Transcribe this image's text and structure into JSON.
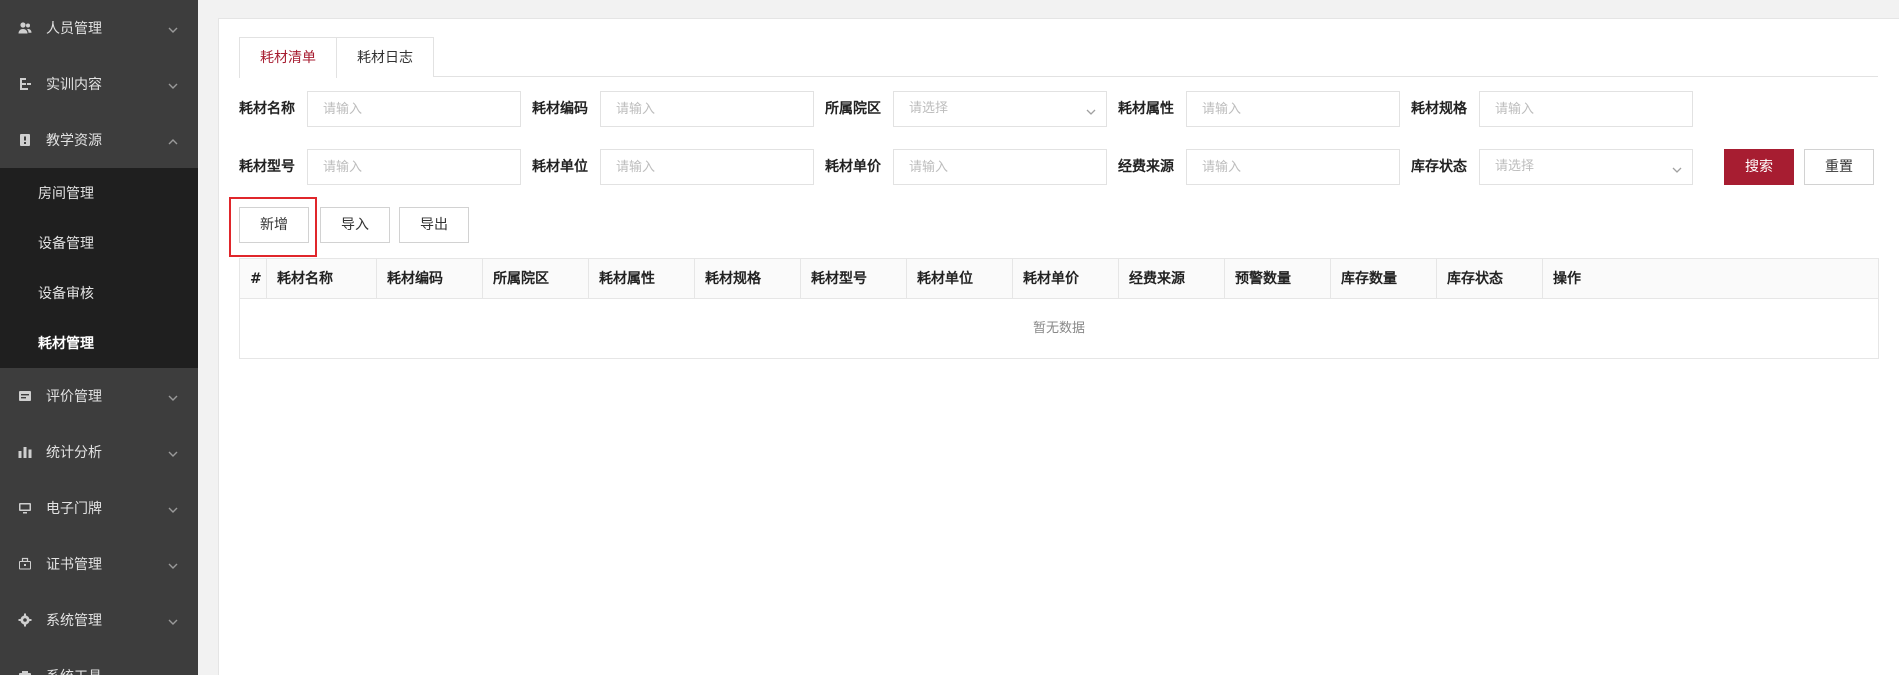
{
  "sidebar": {
    "items": [
      {
        "label": "人员管理",
        "icon": "users-icon"
      },
      {
        "label": "实训内容",
        "icon": "clipboard-icon"
      },
      {
        "label": "教学资源",
        "icon": "book-icon",
        "expanded": true,
        "children": [
          {
            "label": "房间管理"
          },
          {
            "label": "设备管理"
          },
          {
            "label": "设备审核"
          },
          {
            "label": "耗材管理",
            "active": true
          }
        ]
      },
      {
        "label": "评价管理",
        "icon": "rating-icon"
      },
      {
        "label": "统计分析",
        "icon": "bar-chart-icon"
      },
      {
        "label": "电子门牌",
        "icon": "monitor-icon"
      },
      {
        "label": "证书管理",
        "icon": "briefcase-icon"
      },
      {
        "label": "系统管理",
        "icon": "gear-icon"
      },
      {
        "label": "系统工具",
        "icon": "tool-icon"
      }
    ]
  },
  "tabs": [
    {
      "label": "耗材清单",
      "active": true
    },
    {
      "label": "耗材日志"
    }
  ],
  "filters": {
    "name": {
      "label": "耗材名称",
      "placeholder": "请输入"
    },
    "code": {
      "label": "耗材编码",
      "placeholder": "请输入"
    },
    "campus": {
      "label": "所属院区",
      "placeholder": "请选择"
    },
    "attr": {
      "label": "耗材属性",
      "placeholder": "请输入"
    },
    "spec": {
      "label": "耗材规格",
      "placeholder": "请输入"
    },
    "model": {
      "label": "耗材型号",
      "placeholder": "请输入"
    },
    "unit": {
      "label": "耗材单位",
      "placeholder": "请输入"
    },
    "price": {
      "label": "耗材单价",
      "placeholder": "请输入"
    },
    "fund": {
      "label": "经费来源",
      "placeholder": "请输入"
    },
    "stock_status": {
      "label": "库存状态",
      "placeholder": "请选择"
    }
  },
  "actions": {
    "search": "搜索",
    "reset": "重置",
    "add": "新增",
    "import": "导入",
    "export": "导出"
  },
  "table": {
    "columns": [
      "#",
      "耗材名称",
      "耗材编码",
      "所属院区",
      "耗材属性",
      "耗材规格",
      "耗材型号",
      "耗材单位",
      "耗材单价",
      "经费来源",
      "预警数量",
      "库存数量",
      "库存状态",
      "操作"
    ],
    "empty_text": "暂无数据"
  },
  "colors": {
    "primary": "#a71d31",
    "sidebar_bg": "#3d3d3d",
    "submenu_bg": "#1f1f1f",
    "highlight": "#e0262b"
  }
}
